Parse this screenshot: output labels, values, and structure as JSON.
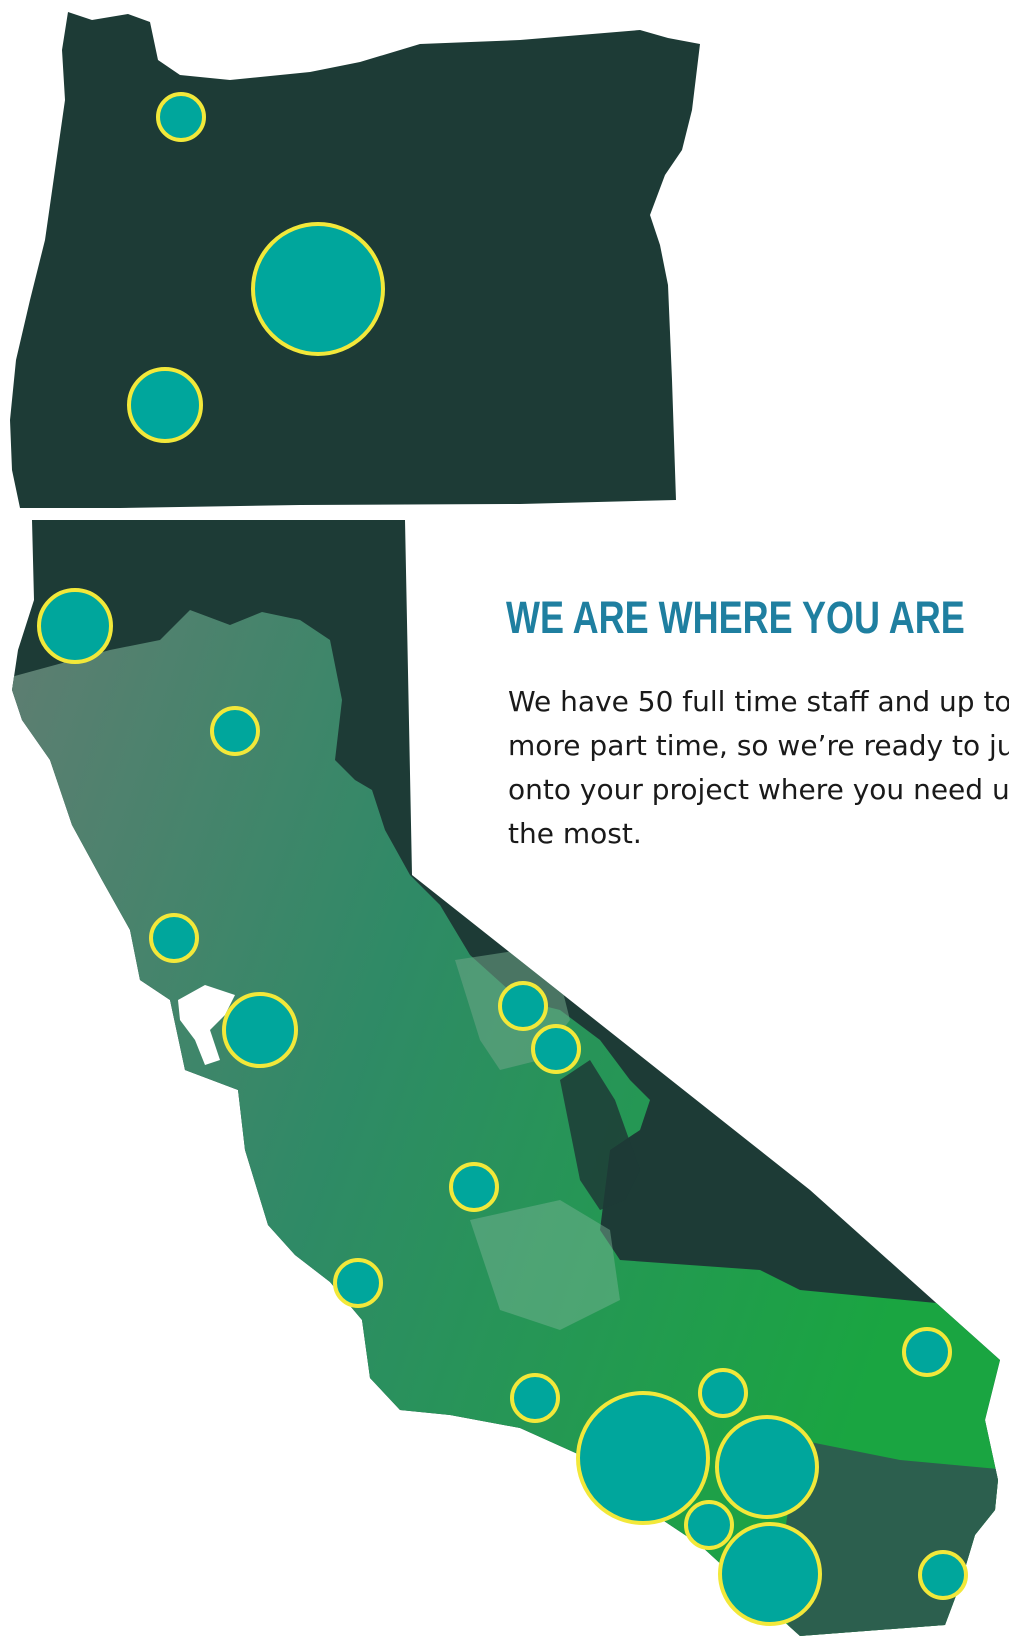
{
  "heading": "WE ARE WHERE YOU ARE",
  "body": {
    "lines": [
      "We have 50 full time staff and up to",
      "more part time, so we’re ready to jump",
      "onto your project where you need us",
      "the most."
    ]
  },
  "map": {
    "regions": [
      "Oregon",
      "California"
    ],
    "colors": {
      "oregon_fill": "#1d3b36",
      "marker_fill": "#00a69c",
      "marker_stroke": "#f2e83a",
      "heading": "#1f7fa0",
      "ca_gradient_start": "#5e8a78",
      "ca_gradient_end": "#1fa545"
    },
    "markers": [
      {
        "id": "or-1",
        "size": "small"
      },
      {
        "id": "or-2",
        "size": "large"
      },
      {
        "id": "or-3",
        "size": "medium"
      },
      {
        "id": "ca-1",
        "size": "medium"
      },
      {
        "id": "ca-2",
        "size": "small"
      },
      {
        "id": "ca-3",
        "size": "small"
      },
      {
        "id": "ca-4",
        "size": "medium"
      },
      {
        "id": "ca-5",
        "size": "small"
      },
      {
        "id": "ca-6",
        "size": "small"
      },
      {
        "id": "ca-7",
        "size": "small"
      },
      {
        "id": "ca-8",
        "size": "small"
      },
      {
        "id": "ca-9",
        "size": "small"
      },
      {
        "id": "ca-10",
        "size": "small"
      },
      {
        "id": "ca-11",
        "size": "large"
      },
      {
        "id": "ca-12",
        "size": "small"
      },
      {
        "id": "ca-13",
        "size": "large"
      },
      {
        "id": "ca-14",
        "size": "small"
      },
      {
        "id": "ca-15",
        "size": "large"
      },
      {
        "id": "ca-16",
        "size": "small"
      }
    ]
  }
}
